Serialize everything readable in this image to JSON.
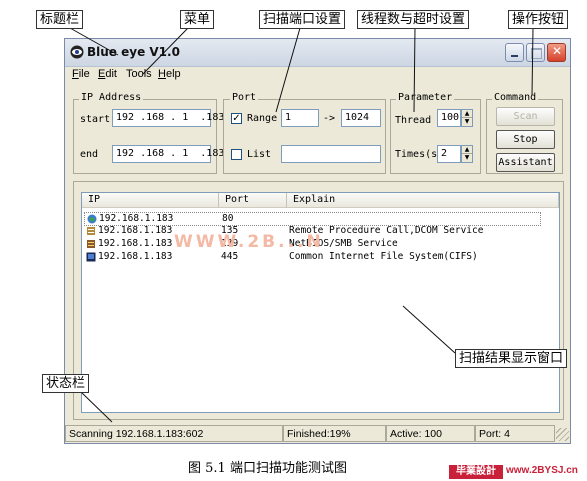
{
  "window": {
    "title": "Blue eye V1.0",
    "menu": [
      {
        "key": "F",
        "rest": "ile"
      },
      {
        "key": "E",
        "rest": "dit"
      },
      {
        "key": "",
        "rest": "Tools"
      },
      {
        "key": "H",
        "rest": "elp"
      }
    ]
  },
  "ip_address": {
    "group_label": "IP Address",
    "start_label": "start",
    "start_value": "192 .168 . 1  .183",
    "end_label": "end",
    "end_value": "192 .168 . 1  .183"
  },
  "port": {
    "group_label": "Port",
    "range_checked": true,
    "range_label": "Range",
    "range_from": "1",
    "arrow": "->",
    "range_to": "1024",
    "list_checked": false,
    "list_label": "List",
    "list_value": ""
  },
  "parameter": {
    "group_label": "Parameter",
    "thread_label": "Thread",
    "thread_value": "100",
    "times_label": "Times(s)",
    "times_value": "2"
  },
  "command": {
    "group_label": "Command",
    "scan_label": "Scan",
    "stop_label": "Stop",
    "assistant_label": "Assistant"
  },
  "results": {
    "columns": [
      "IP",
      "Port",
      "Explain"
    ],
    "rows": [
      {
        "ip": "192.168.1.183",
        "port": "80",
        "explain": "",
        "icon": "globe-icon"
      },
      {
        "ip": "192.168.1.183",
        "port": "135",
        "explain": "Remote Procedure Call,DCOM Service",
        "icon": "server-icon"
      },
      {
        "ip": "192.168.1.183",
        "port": "139",
        "explain": "NetBIOS/SMB Service",
        "icon": "server-icon"
      },
      {
        "ip": "192.168.1.183",
        "port": "445",
        "explain": "Common Internet File System(CIFS)",
        "icon": "terminal-icon"
      }
    ]
  },
  "status": {
    "scanning": "Scanning 192.168.1.183:602",
    "finished": "Finished:19%",
    "active": "Active: 100",
    "port": "Port: 4"
  },
  "annotations": {
    "title_bar": "标题栏",
    "menu": "菜单",
    "port_setting": "扫描端口设置",
    "thread_timeout": "线程数与超时设置",
    "buttons": "操作按钮",
    "result_window": "扫描结果显示窗口",
    "status_bar": "状态栏"
  },
  "caption": "图 5.1  端口扫描功能测试图",
  "watermark": "WWW.2B...N",
  "badge": "毕業設計",
  "site": "www.2BYSJ.cn",
  "colors": {
    "title_gradient": "#cdd6e3",
    "close": "#d5412b",
    "watermark": "#f4b9a4",
    "badge": "#c9213a"
  }
}
